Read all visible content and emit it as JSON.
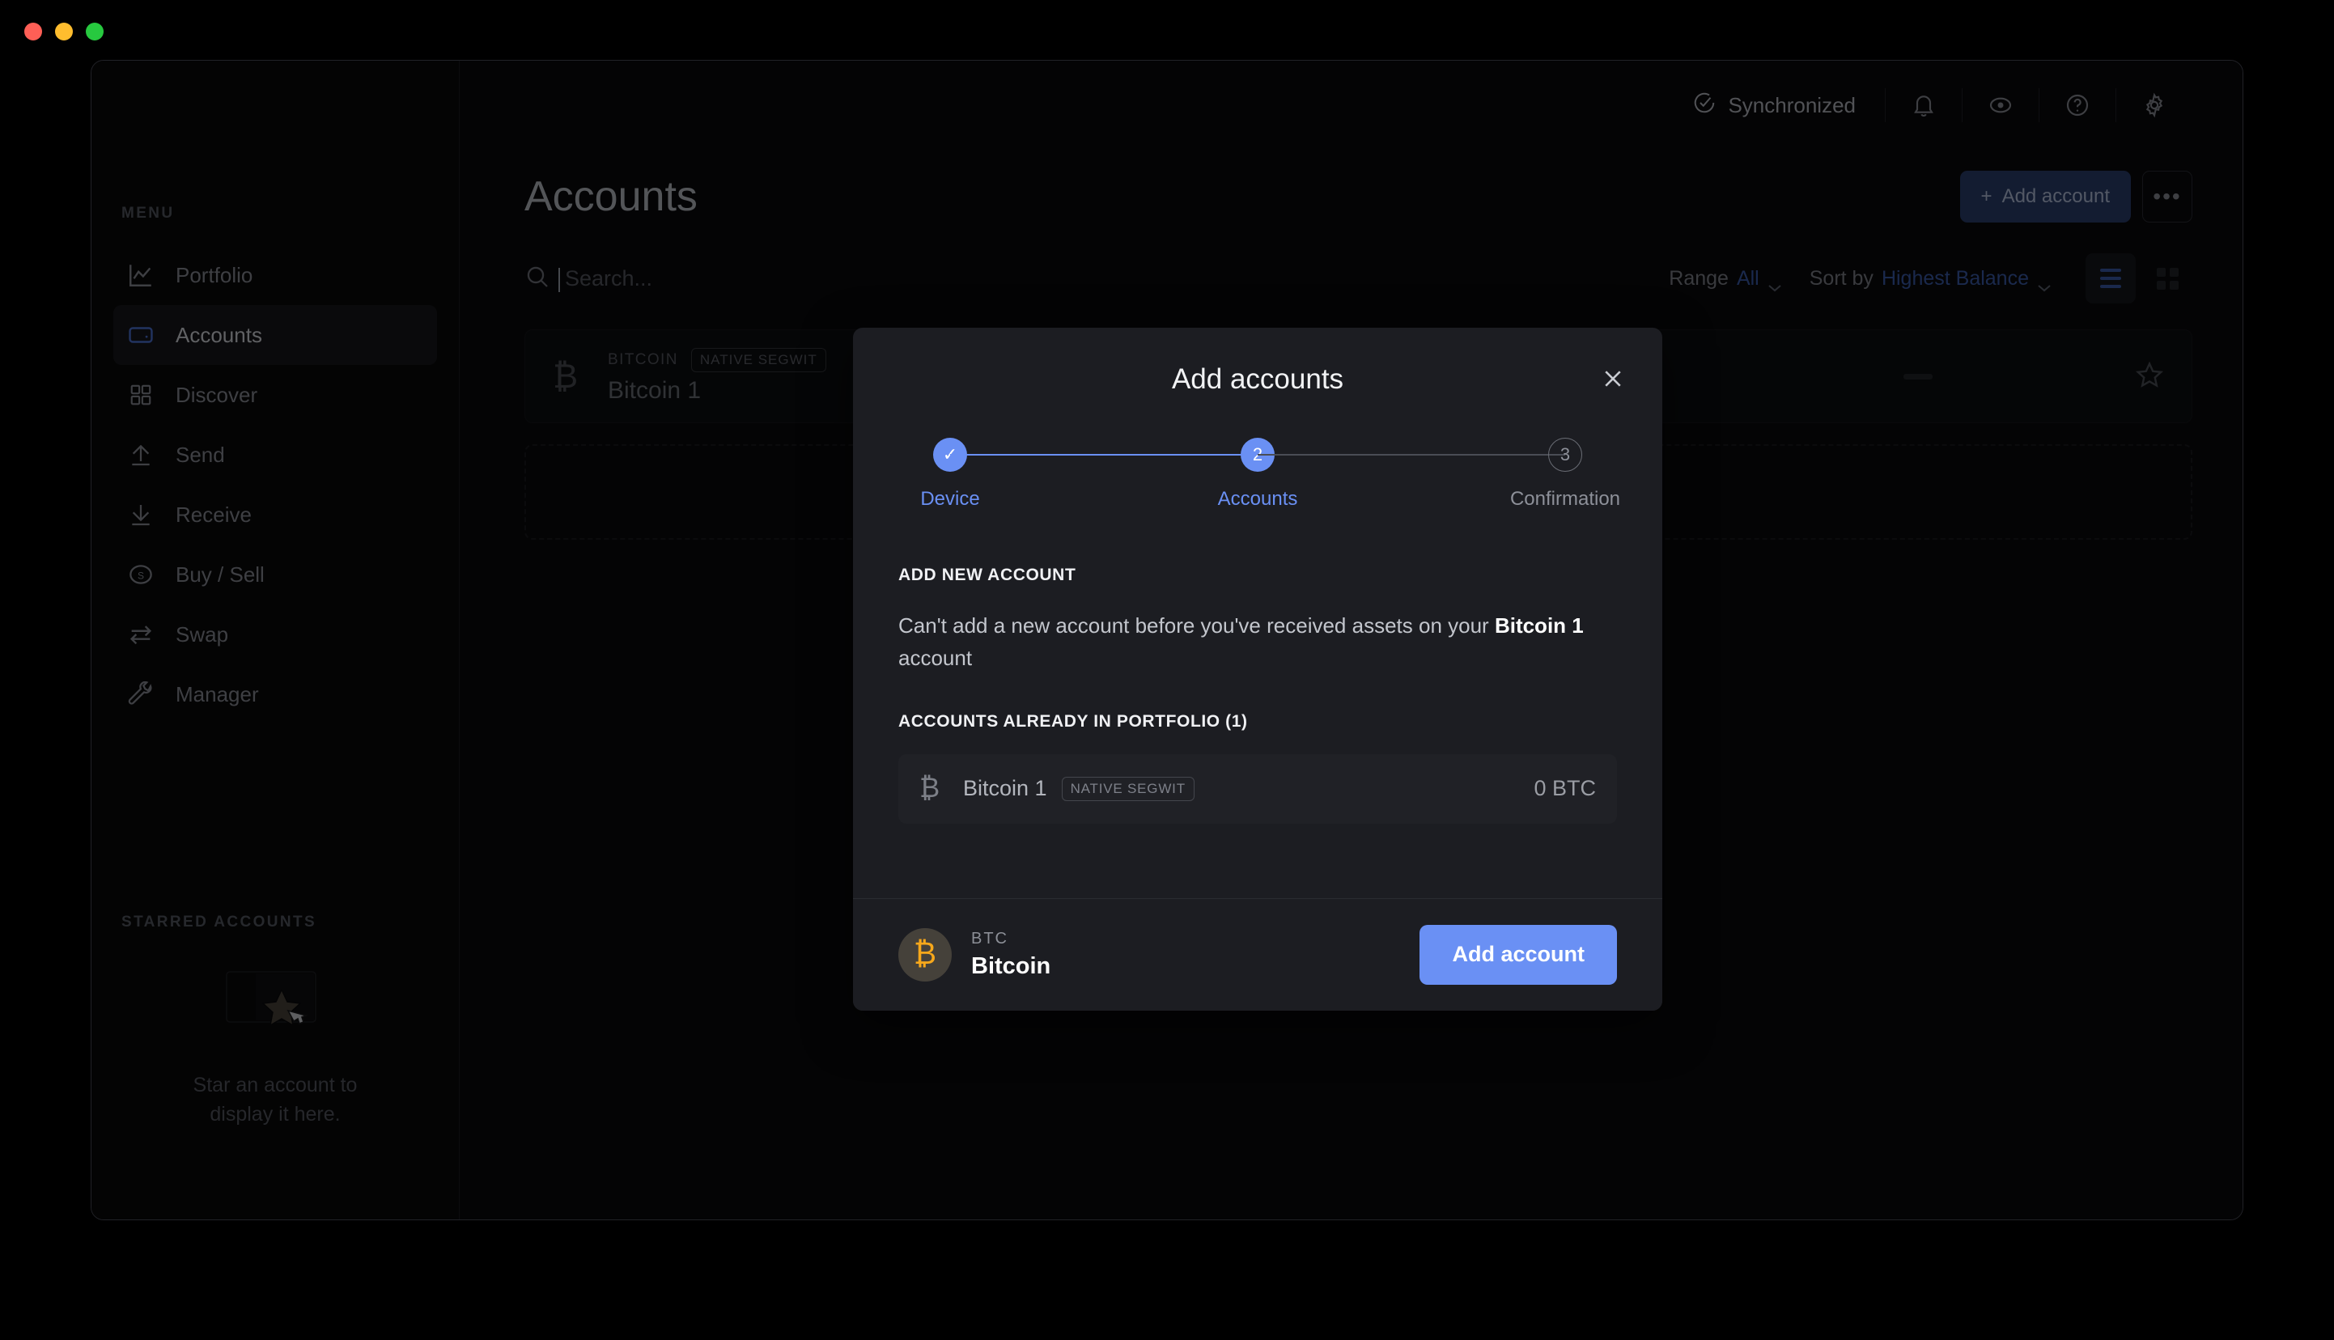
{
  "window": {
    "traffic_lights": [
      {
        "name": "close",
        "color": "#ff5f56"
      },
      {
        "name": "minimize",
        "color": "#ffbd2e"
      },
      {
        "name": "maximize",
        "color": "#27c93f"
      }
    ]
  },
  "sidebar": {
    "menu_label": "MENU",
    "items": [
      {
        "label": "Portfolio",
        "icon": "chart-line-icon",
        "active": false
      },
      {
        "label": "Accounts",
        "icon": "wallet-icon",
        "active": true
      },
      {
        "label": "Discover",
        "icon": "grid-icon",
        "active": false
      },
      {
        "label": "Send",
        "icon": "arrow-up-icon",
        "active": false
      },
      {
        "label": "Receive",
        "icon": "arrow-down-icon",
        "active": false
      },
      {
        "label": "Buy / Sell",
        "icon": "dollar-circle-icon",
        "active": false
      },
      {
        "label": "Swap",
        "icon": "swap-arrows-icon",
        "active": false
      },
      {
        "label": "Manager",
        "icon": "wrench-icon",
        "active": false
      }
    ],
    "starred_label": "STARRED ACCOUNTS",
    "starred_empty_text": "Star an account to display it here."
  },
  "topbar": {
    "sync_status": "Synchronized",
    "icons": [
      "bell-icon",
      "eye-icon",
      "help-circle-icon",
      "gear-icon"
    ]
  },
  "page": {
    "title": "Accounts",
    "add_account_label": "Add account",
    "more_label": "•••"
  },
  "filters": {
    "search_placeholder": "Search...",
    "range_label": "Range",
    "range_value": "All",
    "sort_label": "Sort by",
    "sort_value": "Highest Balance",
    "view_list": "list-view",
    "view_grid": "grid-view"
  },
  "account_row": {
    "ticker": "BITCOIN",
    "badge": "NATIVE SEGWIT",
    "name": "Bitcoin 1",
    "value_placeholder": "—",
    "balance_placeholder": "—"
  },
  "modal": {
    "title": "Add accounts",
    "close_label": "×",
    "steps": [
      {
        "marker": "✓",
        "label": "Device",
        "state": "done"
      },
      {
        "marker": "2",
        "label": "Accounts",
        "state": "current"
      },
      {
        "marker": "3",
        "label": "Confirmation",
        "state": "todo"
      }
    ],
    "add_new_account_heading": "ADD NEW ACCOUNT",
    "cannot_add_prefix": "Can't add a new account before you've received assets on your ",
    "cannot_add_bold": "Bitcoin 1",
    "cannot_add_suffix": " account",
    "portfolio_heading": "ACCOUNTS ALREADY IN PORTFOLIO (1)",
    "portfolio_accounts": [
      {
        "name": "Bitcoin 1",
        "badge": "NATIVE SEGWIT",
        "balance": "0 BTC",
        "icon": "bitcoin-icon"
      }
    ],
    "footer": {
      "coin_ticker": "BTC",
      "coin_name": "Bitcoin",
      "coin_symbol": "₿",
      "add_button_label": "Add account"
    }
  },
  "colors": {
    "accent_blue": "#6a90f4",
    "link_blue": "#3b5caa",
    "bitcoin_orange": "#f7a81b",
    "modal_bg": "#1c1d22",
    "app_bg": "#0b0b0c"
  }
}
